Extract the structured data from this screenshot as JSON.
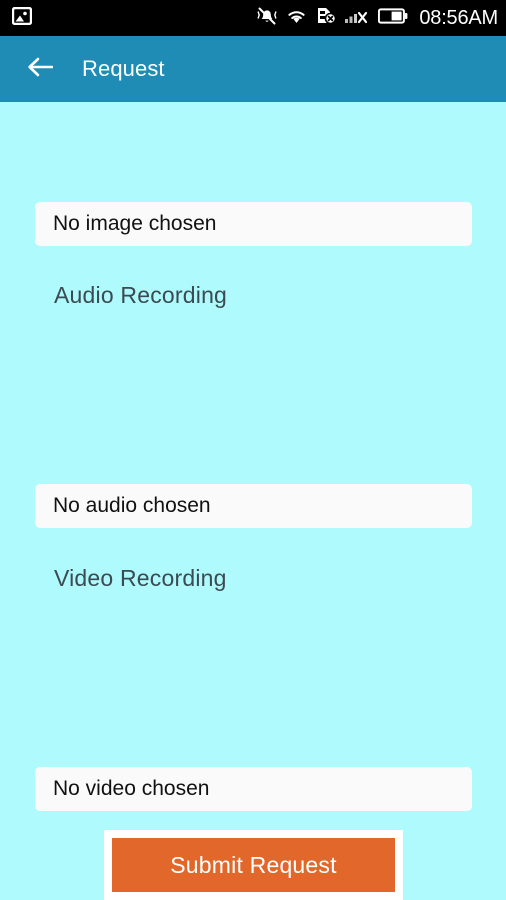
{
  "statusbar": {
    "background_color": "#000000",
    "notification_icons": [
      {
        "name": "image-notification-icon",
        "label": "image"
      }
    ],
    "system_icons": [
      {
        "name": "silent-vibrate-icon",
        "label": "silent"
      },
      {
        "name": "wifi-icon",
        "label": "wifi"
      },
      {
        "name": "sim-card-missing-icon",
        "label": "no sim"
      },
      {
        "name": "signal-no-service-icon",
        "label": "no signal"
      },
      {
        "name": "battery-icon",
        "label": "battery"
      }
    ],
    "time": "08:56AM"
  },
  "appbar": {
    "background_color": "#1E8CB5",
    "back_icon": "arrow-left-icon",
    "title": "Request"
  },
  "screen": {
    "background_color": "#AEFAFD"
  },
  "form": {
    "image": {
      "field_value": "No image chosen"
    },
    "audio": {
      "section_label": "Audio Recording",
      "field_value": "No audio chosen"
    },
    "video": {
      "section_label": "Video Recording",
      "field_value": "No video chosen"
    }
  },
  "submit": {
    "label": "Submit Request",
    "color": "#E2672A"
  }
}
